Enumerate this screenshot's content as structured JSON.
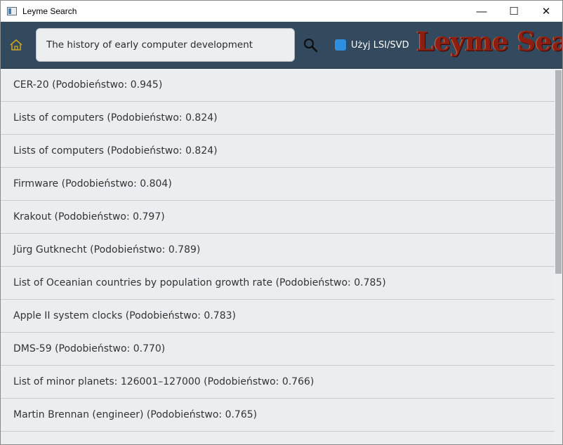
{
  "window": {
    "title": "Leyme Search"
  },
  "window_controls": {
    "minimize": "—",
    "maximize": "☐",
    "close": "✕"
  },
  "toolbar": {
    "home_icon": "home-icon",
    "search_query": "The history of early computer development",
    "search_icon": "search-icon",
    "lsi_label": "Użyj LSI/SVD",
    "lsi_checked": true,
    "brand": "Leyme Search"
  },
  "results": [
    {
      "label": "CER-20 (Podobieństwo: 0.945)"
    },
    {
      "label": "Lists of computers (Podobieństwo: 0.824)"
    },
    {
      "label": "Lists of computers (Podobieństwo: 0.824)"
    },
    {
      "label": "Firmware (Podobieństwo: 0.804)"
    },
    {
      "label": "Krakout (Podobieństwo: 0.797)"
    },
    {
      "label": "Jürg Gutknecht (Podobieństwo: 0.789)"
    },
    {
      "label": "List of Oceanian countries by population growth rate (Podobieństwo: 0.785)"
    },
    {
      "label": "Apple II system clocks (Podobieństwo: 0.783)"
    },
    {
      "label": "DMS-59 (Podobieństwo: 0.770)"
    },
    {
      "label": "List of minor planets: 126001–127000 (Podobieństwo: 0.766)"
    },
    {
      "label": "Martin Brennan (engineer) (Podobieństwo: 0.765)"
    },
    {
      "label": ""
    }
  ],
  "colors": {
    "toolbar_bg": "#33495d",
    "list_bg": "#ebeef0",
    "checkbox_accent": "#2d8fe0",
    "brand_red": "#8f1e12"
  }
}
